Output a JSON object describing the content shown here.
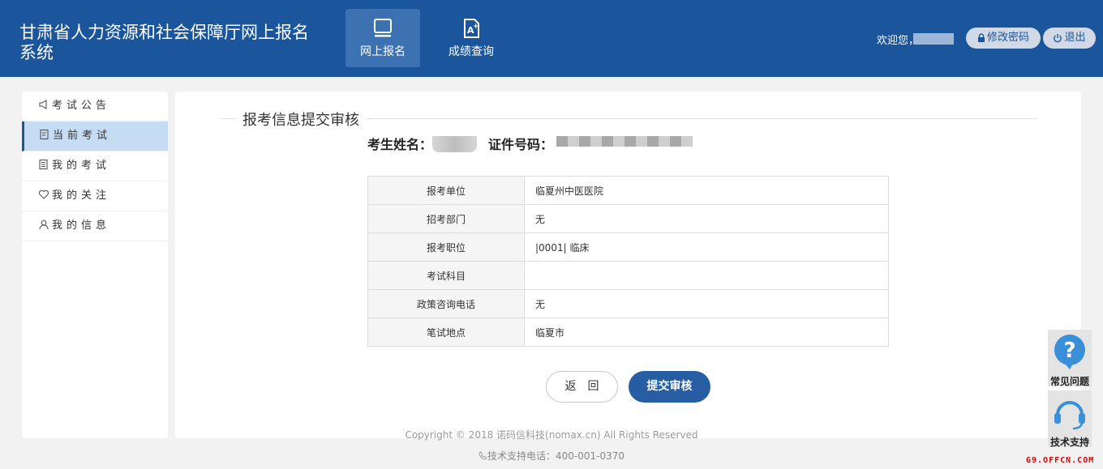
{
  "header": {
    "title": "甘肃省人力资源和社会保障厅网上报名系统",
    "nav": [
      {
        "label": "网上报名",
        "icon": "monitor-icon",
        "active": true
      },
      {
        "label": "成绩查询",
        "icon": "score-document-icon",
        "active": false
      }
    ],
    "welcome": "欢迎您，",
    "change_password": "修改密码",
    "logout": "退出"
  },
  "sidebar": {
    "items": [
      {
        "label": "考试公告",
        "icon": "megaphone-icon"
      },
      {
        "label": "当前考试",
        "icon": "edit-document-icon",
        "active": true
      },
      {
        "label": "我的考试",
        "icon": "document-list-icon"
      },
      {
        "label": "我的关注",
        "icon": "heart-icon"
      },
      {
        "label": "我的信息",
        "icon": "user-icon"
      }
    ]
  },
  "main": {
    "section_title": "报考信息提交审核",
    "candidate_name_label": "考生姓名：",
    "id_number_label": "证件号码：",
    "rows": [
      {
        "key": "报考单位",
        "value": "临夏州中医医院"
      },
      {
        "key": "招考部门",
        "value": "无"
      },
      {
        "key": "报考职位",
        "value": "|0001| 临床"
      },
      {
        "key": "考试科目",
        "value": ""
      },
      {
        "key": "政策咨询电话",
        "value": "无"
      },
      {
        "key": "笔试地点",
        "value": "临夏市"
      }
    ],
    "back_button": "返回",
    "submit_button": "提交审核"
  },
  "footer": {
    "copyright": "Copyright © 2018 诺码信科技(nomax.cn) All Rights Reserved",
    "support": "技术支持电话：400-001-0370"
  },
  "float": {
    "faq": "常见问题",
    "tech_support": "技术支持"
  },
  "watermark": "G9.OFFCN.COM",
  "colors": {
    "header_bg": "#1b559b",
    "nav_active_bg": "#3c72b1",
    "submit_bg": "#275ea3",
    "sidebar_active_bg": "#c6dcf4",
    "page_bg": "#f2f2f2"
  }
}
